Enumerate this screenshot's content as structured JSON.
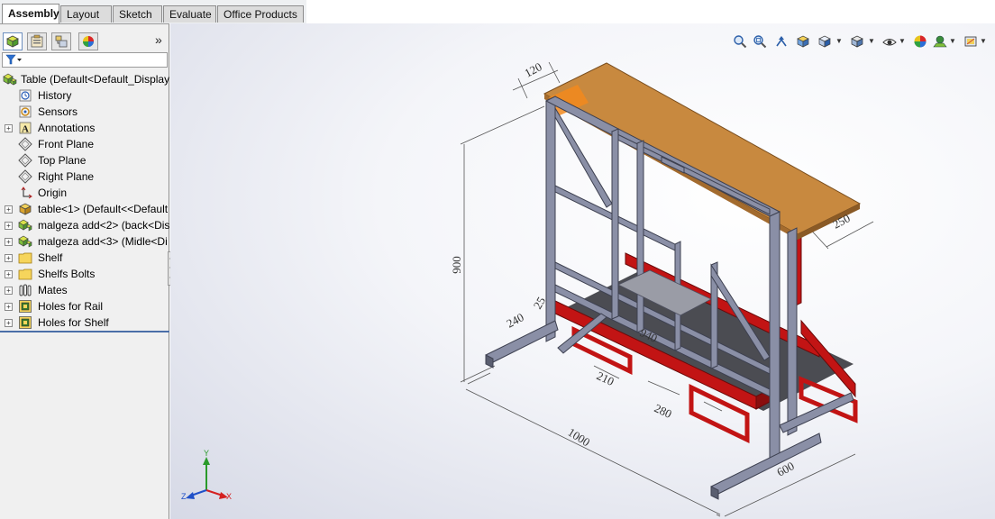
{
  "tabs": [
    {
      "label": "Assembly",
      "active": true
    },
    {
      "label": "Layout",
      "active": false
    },
    {
      "label": "Sketch",
      "active": false
    },
    {
      "label": "Evaluate",
      "active": false
    },
    {
      "label": "Office Products",
      "active": false
    }
  ],
  "manager": {
    "buttons": [
      "feature-manager-icon",
      "property-manager-icon",
      "configuration-manager-icon",
      "appearance-manager-icon"
    ],
    "expand_glyph": "»",
    "filter_icon": "filter-icon"
  },
  "tree": {
    "root": {
      "label": "Table  (Default<Default_Display",
      "icon": "assembly-icon"
    },
    "items": [
      {
        "label": "History",
        "icon": "history-icon",
        "expandable": false
      },
      {
        "label": "Sensors",
        "icon": "sensors-icon",
        "expandable": false
      },
      {
        "label": "Annotations",
        "icon": "annotations-icon",
        "expandable": true
      },
      {
        "label": "Front Plane",
        "icon": "plane-icon",
        "expandable": false
      },
      {
        "label": "Top Plane",
        "icon": "plane-icon",
        "expandable": false
      },
      {
        "label": "Right Plane",
        "icon": "plane-icon",
        "expandable": false
      },
      {
        "label": "Origin",
        "icon": "origin-icon",
        "expandable": false
      },
      {
        "label": "table<1> (Default<<Default",
        "icon": "part-icon",
        "expandable": true
      },
      {
        "label": "malgeza add<2> (back<Dis",
        "icon": "subassembly-icon",
        "expandable": true
      },
      {
        "label": "malgeza add<3> (Midle<Di",
        "icon": "subassembly-icon",
        "expandable": true
      },
      {
        "label": "Shelf",
        "icon": "folder-icon",
        "expandable": true
      },
      {
        "label": "Shelfs Bolts",
        "icon": "folder-icon",
        "expandable": true
      },
      {
        "label": "Mates",
        "icon": "mates-icon",
        "expandable": true
      },
      {
        "label": "Holes for Rail",
        "icon": "hole-series-icon",
        "expandable": true
      },
      {
        "label": "Holes for Shelf",
        "icon": "hole-series-icon",
        "expandable": true
      }
    ]
  },
  "headsup_toolbar": [
    "zoom-to-fit-icon",
    "zoom-to-area-icon",
    "previous-view-icon",
    "section-view-icon",
    "view-orientation-icon",
    "display-style-icon",
    "hide-show-items-icon",
    "edit-appearance-icon",
    "apply-scene-icon",
    "view-settings-icon"
  ],
  "dimensions": {
    "d120": "120",
    "d900": "900",
    "d250": "250",
    "d240": "240",
    "d25": "25",
    "d940": "940",
    "d210": "210",
    "d280": "280",
    "d1000": "1000",
    "d600": "600"
  },
  "triad": {
    "x": "X",
    "y": "Y",
    "z": "Z"
  },
  "colors": {
    "frame": "#8a8fa6",
    "frame_dark": "#5a5e70",
    "rail": "#c21414",
    "tabletop": "#c8893f",
    "shelf": "#8d8f98",
    "tree_accent": "#4b6fa8"
  }
}
